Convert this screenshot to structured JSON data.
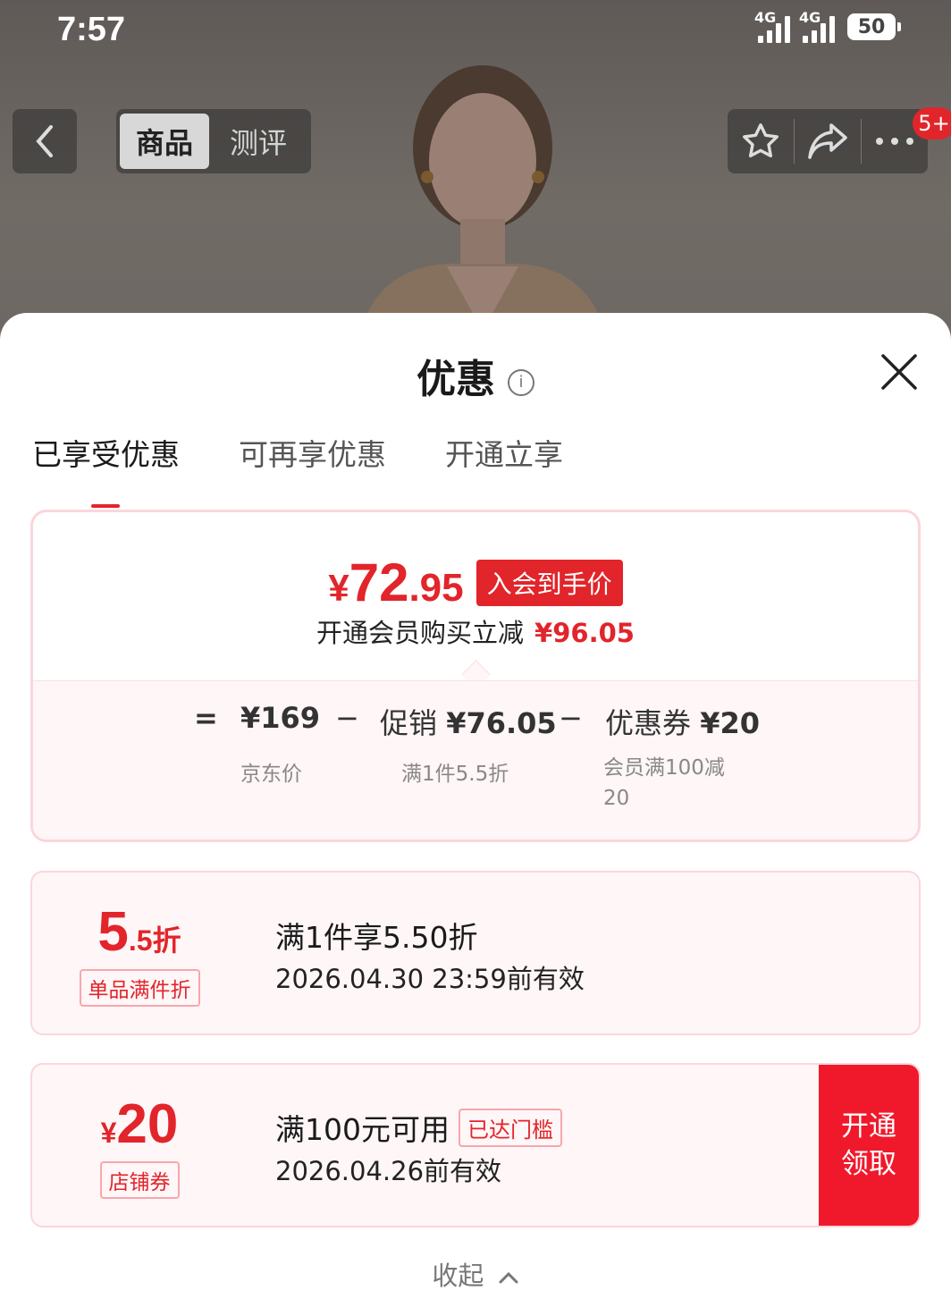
{
  "status_bar": {
    "time": "7:57",
    "network1": "4G",
    "network2": "4G",
    "battery": "50"
  },
  "top_nav": {
    "tabs": [
      "商品",
      "测评"
    ],
    "badge": "5+"
  },
  "sheet": {
    "title": "优惠",
    "info_glyph": "i",
    "tabs": [
      "已享受优惠",
      "可再享优惠",
      "开通立享"
    ],
    "summary": {
      "currency": "¥",
      "price_int": "72",
      "price_dec": ".95",
      "price_tag": "入会到手价",
      "save_text": "开通会员购买立减",
      "save_amount": "¥96.05",
      "equals": "=",
      "minus": "−",
      "jd_price": "¥169",
      "jd_label": "京东价",
      "promo_prefix": "促销",
      "promo_amount": "¥76.05",
      "promo_label": "满1件5.5折",
      "coupon_prefix": "优惠券",
      "coupon_amount": "¥20",
      "coupon_label_line1": "会员满100减",
      "coupon_label_line2": "20"
    },
    "coupons": [
      {
        "big_main": "5",
        "big_sub": ".5折",
        "type": "单品满件折",
        "title": "满1件享5.50折",
        "date": "2026.04.30 23:59前有效"
      },
      {
        "currency": "¥",
        "big_main": "20",
        "type": "店铺券",
        "title": "满100元可用",
        "reached": "已达门槛",
        "date": "2026.04.26前有效",
        "claim_line1": "开通",
        "claim_line2": "领取"
      }
    ],
    "collapse": "收起"
  },
  "colors": {
    "accent": "#e1252b",
    "claim_bg": "#f0192c",
    "border_pink": "#fbd6db"
  }
}
